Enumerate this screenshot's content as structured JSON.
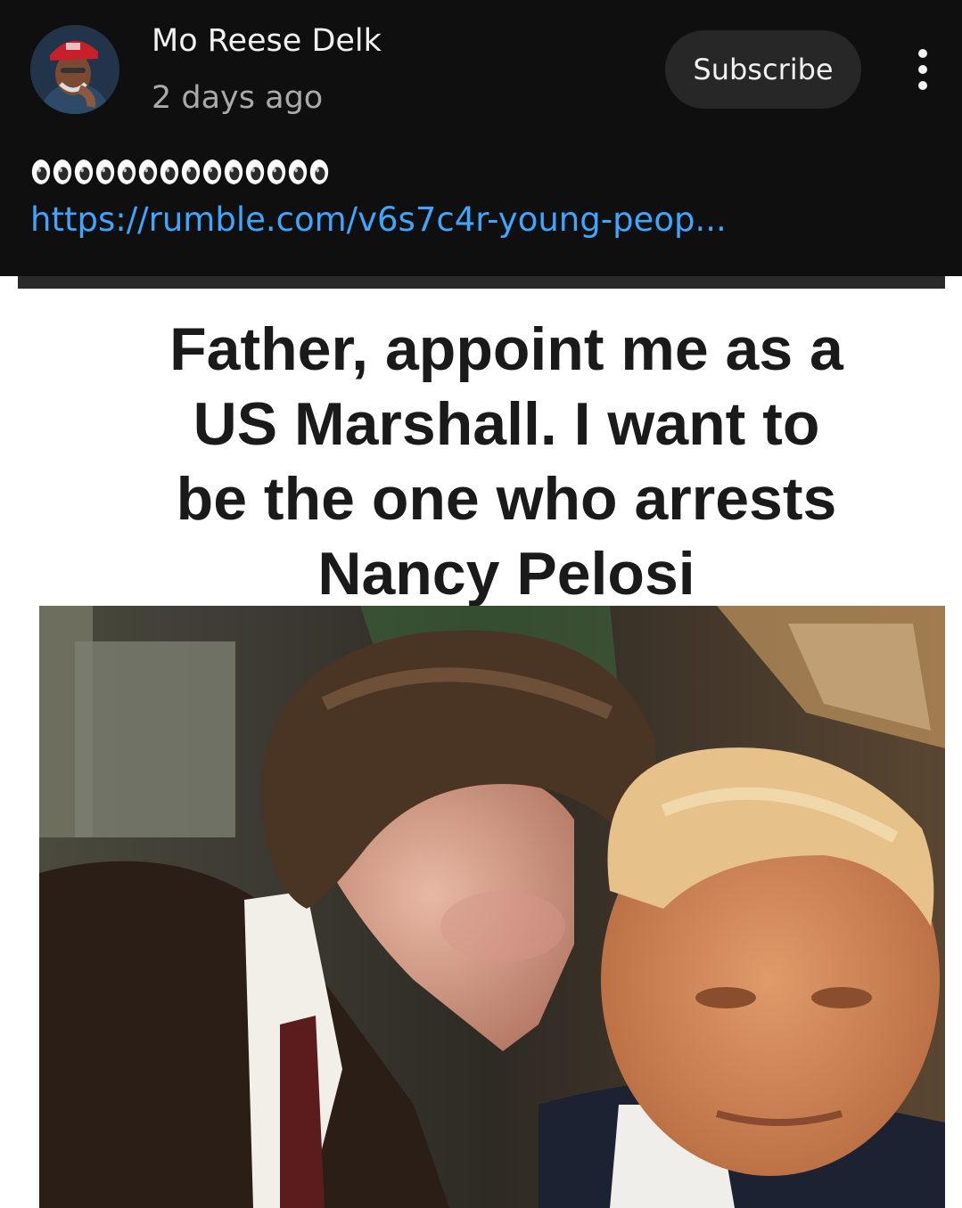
{
  "post": {
    "author": "Mo Reese Delk",
    "time": "2 days ago",
    "subscribe_label": "Subscribe",
    "emoji_text": "👀👀👀👀👀👀👀👀👀👀👀👀👀👀",
    "emoji_icon": "eyes-emoji",
    "emoji_count": 14,
    "link": "https://rumble.com/v6s7c4r-young-peop..."
  },
  "meme": {
    "caption_lines": [
      "Father, appoint me as a",
      "US Marshall. I want to",
      "be the one who arrests",
      "Nancy Pelosi"
    ]
  },
  "colors": {
    "header_bg": "#0f0f0f",
    "button_bg": "#272727",
    "link": "#3ea6ff",
    "secondary_text": "#aaaaaa"
  }
}
